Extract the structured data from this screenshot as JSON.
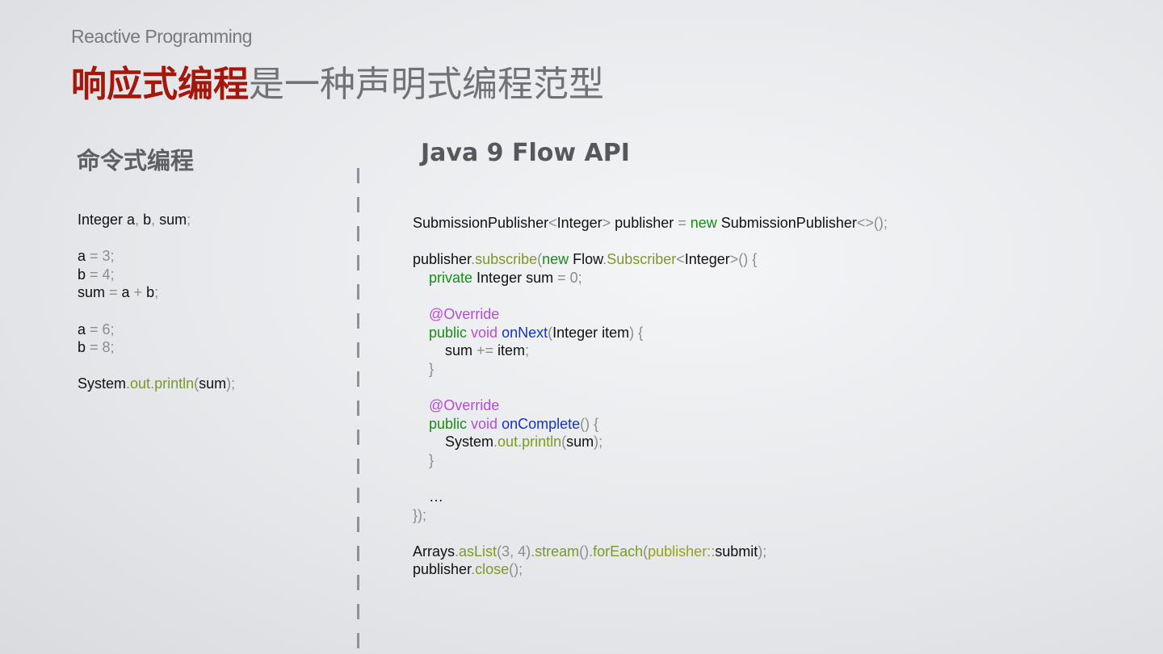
{
  "header": {
    "subtitle": "Reactive Programming",
    "title_accent": "响应式编程",
    "title_rest": "是一种声明式编程范型"
  },
  "left": {
    "heading": "命令式编程",
    "code_lines": [
      [
        [
          "t",
          "Integer a"
        ],
        [
          "p",
          ", "
        ],
        [
          "t",
          "b"
        ],
        [
          "p",
          ", "
        ],
        [
          "t",
          "sum"
        ],
        [
          "p",
          ";"
        ]
      ],
      [],
      [
        [
          "t",
          "a "
        ],
        [
          "p",
          "= 3;"
        ]
      ],
      [
        [
          "t",
          "b "
        ],
        [
          "p",
          "= 4;"
        ]
      ],
      [
        [
          "t",
          "sum "
        ],
        [
          "p",
          "= "
        ],
        [
          "t",
          "a "
        ],
        [
          "p",
          "+ "
        ],
        [
          "t",
          "b"
        ],
        [
          "p",
          ";"
        ]
      ],
      [],
      [
        [
          "t",
          "a "
        ],
        [
          "p",
          "= 6;"
        ]
      ],
      [
        [
          "t",
          "b "
        ],
        [
          "p",
          "= 8;"
        ]
      ],
      [],
      [
        [
          "t",
          "System"
        ],
        [
          "p",
          "."
        ],
        [
          "m",
          "out"
        ],
        [
          "p",
          "."
        ],
        [
          "m",
          "println"
        ],
        [
          "p",
          "("
        ],
        [
          "t",
          "sum"
        ],
        [
          "p",
          ");"
        ]
      ]
    ]
  },
  "right": {
    "heading": "Java 9 Flow API",
    "code_lines": [
      [
        [
          "t",
          "SubmissionPublisher"
        ],
        [
          "p",
          "<"
        ],
        [
          "t",
          "Integer"
        ],
        [
          "p",
          "> "
        ],
        [
          "t",
          "publisher "
        ],
        [
          "p",
          "= "
        ],
        [
          "k",
          "new "
        ],
        [
          "t",
          "SubmissionPublisher"
        ],
        [
          "p",
          "<>();"
        ]
      ],
      [],
      [
        [
          "t",
          "publisher"
        ],
        [
          "p",
          "."
        ],
        [
          "m",
          "subscribe"
        ],
        [
          "p",
          "("
        ],
        [
          "k",
          "new "
        ],
        [
          "t",
          "Flow"
        ],
        [
          "p",
          "."
        ],
        [
          "m",
          "Subscriber"
        ],
        [
          "p",
          "<"
        ],
        [
          "t",
          "Integer"
        ],
        [
          "p",
          ">() {"
        ]
      ],
      [
        [
          "t",
          "    "
        ],
        [
          "k",
          "private "
        ],
        [
          "t",
          "Integer sum "
        ],
        [
          "p",
          "= 0;"
        ]
      ],
      [],
      [
        [
          "t",
          "    "
        ],
        [
          "an",
          "@Override"
        ]
      ],
      [
        [
          "t",
          "    "
        ],
        [
          "k",
          "public "
        ],
        [
          "an",
          "void "
        ],
        [
          "f",
          "onNext"
        ],
        [
          "p",
          "("
        ],
        [
          "t",
          "Integer item"
        ],
        [
          "p",
          ") {"
        ]
      ],
      [
        [
          "t",
          "        sum "
        ],
        [
          "p",
          "+= "
        ],
        [
          "t",
          "item"
        ],
        [
          "p",
          ";"
        ]
      ],
      [
        [
          "t",
          "    "
        ],
        [
          "p",
          "}"
        ]
      ],
      [],
      [
        [
          "t",
          "    "
        ],
        [
          "an",
          "@Override"
        ]
      ],
      [
        [
          "t",
          "    "
        ],
        [
          "k",
          "public "
        ],
        [
          "an",
          "void "
        ],
        [
          "f",
          "onComplete"
        ],
        [
          "p",
          "() {"
        ]
      ],
      [
        [
          "t",
          "        System"
        ],
        [
          "p",
          "."
        ],
        [
          "m",
          "out"
        ],
        [
          "p",
          "."
        ],
        [
          "m",
          "println"
        ],
        [
          "p",
          "("
        ],
        [
          "t",
          "sum"
        ],
        [
          "p",
          ");"
        ]
      ],
      [
        [
          "t",
          "    "
        ],
        [
          "p",
          "}"
        ]
      ],
      [],
      [
        [
          "t",
          "    …"
        ]
      ],
      [
        [
          "p",
          "});"
        ]
      ],
      [],
      [
        [
          "t",
          "Arrays"
        ],
        [
          "p",
          "."
        ],
        [
          "m",
          "asList"
        ],
        [
          "p",
          "(3, 4)."
        ],
        [
          "m",
          "stream"
        ],
        [
          "p",
          "()."
        ],
        [
          "m",
          "forEach"
        ],
        [
          "p",
          "("
        ],
        [
          "y",
          "publisher::"
        ],
        [
          "t",
          "submit"
        ],
        [
          "p",
          ");"
        ]
      ],
      [
        [
          "t",
          "publisher"
        ],
        [
          "p",
          "."
        ],
        [
          "m",
          "close"
        ],
        [
          "p",
          "();"
        ]
      ]
    ]
  },
  "colors": {
    "accent": "#a5170b",
    "keyword": "#1a8a1a",
    "member": "#7c9a23",
    "method": "#1232cf",
    "annotation": "#b34fcf"
  }
}
